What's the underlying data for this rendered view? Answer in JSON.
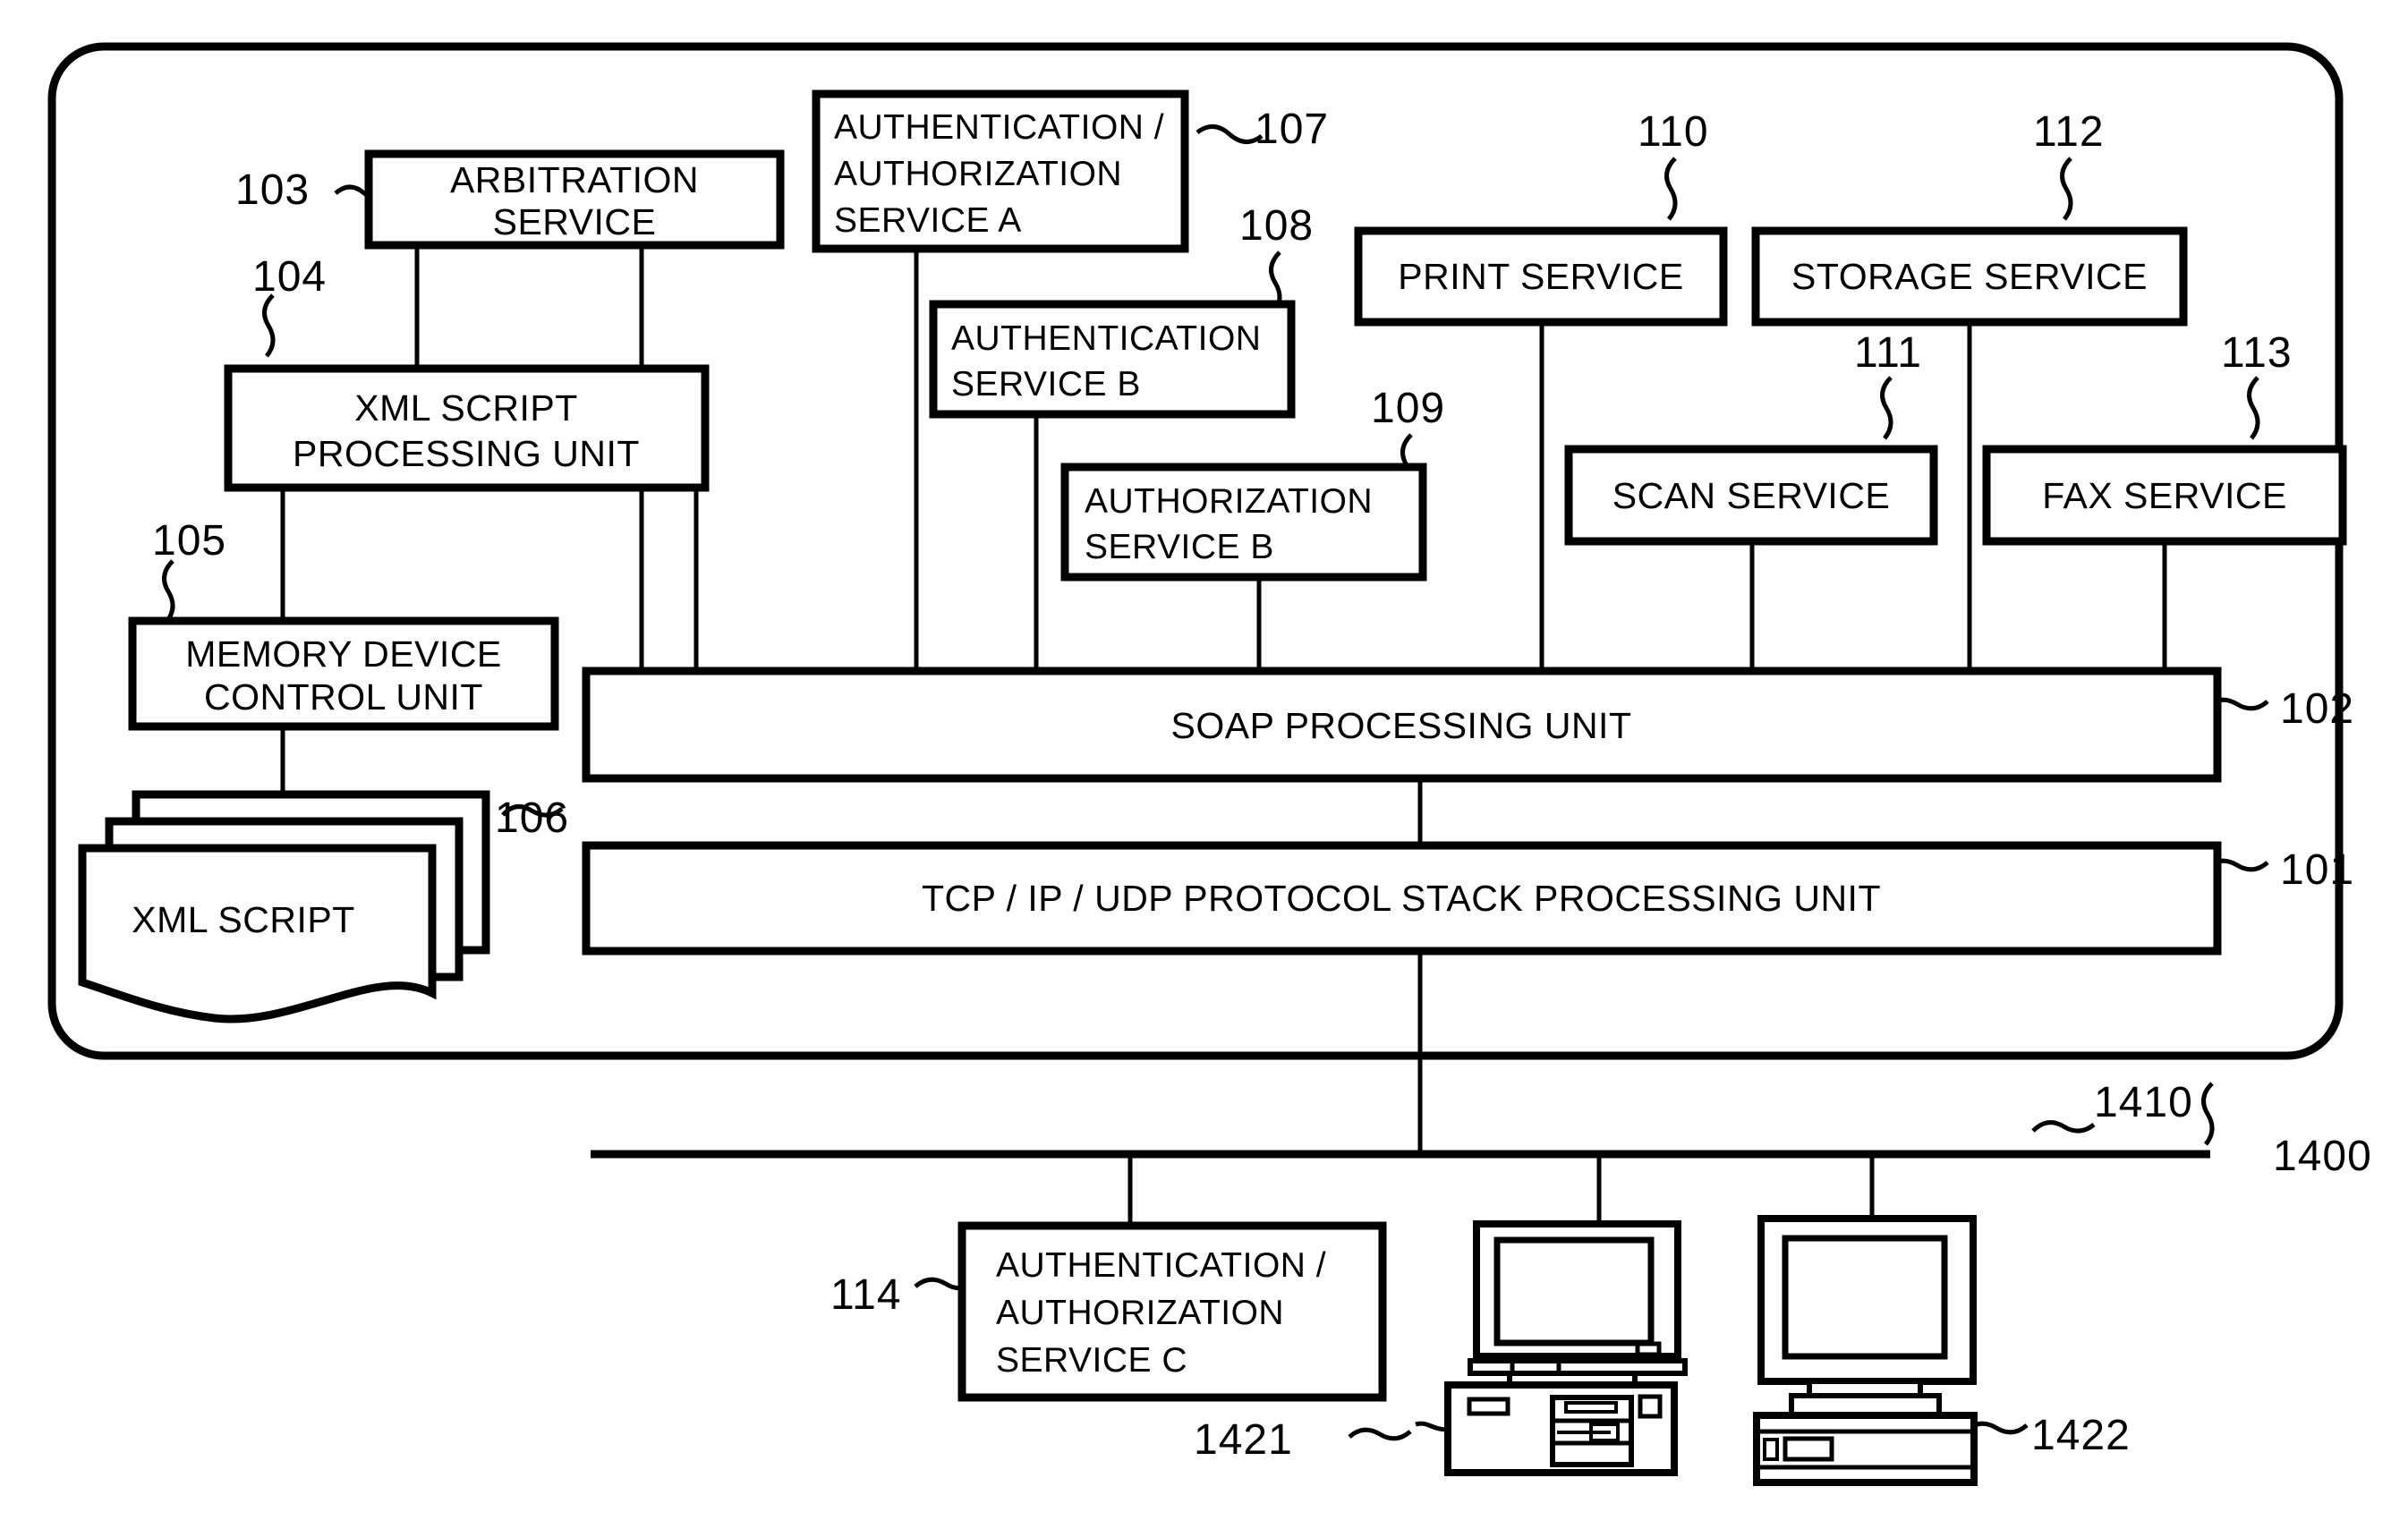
{
  "figure": {
    "type": "patent-block-diagram",
    "description": "Network service architecture block diagram"
  },
  "outer_device": {
    "ref": "",
    "blocks": {
      "arbitration_service": {
        "label_line1": "ARBITRATION",
        "label_line2": "SERVICE",
        "ref": "103"
      },
      "xml_script_processing_unit": {
        "label_line1": "XML SCRIPT",
        "label_line2": "PROCESSING UNIT",
        "ref": "104"
      },
      "memory_device_control_unit": {
        "label_line1": "MEMORY DEVICE",
        "label_line2": "CONTROL UNIT",
        "ref": "105"
      },
      "xml_script": {
        "label": "XML SCRIPT",
        "ref": "106"
      },
      "auth_authz_service_a": {
        "label_line1": "AUTHENTICATION /",
        "label_line2": "AUTHORIZATION",
        "label_line3": "SERVICE A",
        "ref": "107"
      },
      "authentication_service_b": {
        "label_line1": "AUTHENTICATION",
        "label_line2": "SERVICE B",
        "ref": "108"
      },
      "authorization_service_b": {
        "label_line1": "AUTHORIZATION",
        "label_line2": "SERVICE B",
        "ref": "109"
      },
      "print_service": {
        "label": "PRINT SERVICE",
        "ref": "110"
      },
      "scan_service": {
        "label": "SCAN SERVICE",
        "ref": "111"
      },
      "storage_service": {
        "label": "STORAGE SERVICE",
        "ref": "112"
      },
      "fax_service": {
        "label": "FAX SERVICE",
        "ref": "113"
      },
      "soap_processing_unit": {
        "label": "SOAP PROCESSING UNIT",
        "ref": "102"
      },
      "protocol_stack_unit": {
        "label": "TCP / IP / UDP PROTOCOL STACK PROCESSING UNIT",
        "ref": "101"
      }
    }
  },
  "network": {
    "bus_ref": "1410",
    "system_ref": "1400"
  },
  "external_nodes": {
    "auth_authz_service_c": {
      "label_line1": "AUTHENTICATION /",
      "label_line2": "AUTHORIZATION",
      "label_line3": "SERVICE C",
      "ref": "114"
    },
    "computer_1": {
      "ref": "1421",
      "icon": "desktop-computer-icon"
    },
    "computer_2": {
      "ref": "1422",
      "icon": "desktop-computer-icon"
    }
  },
  "colors": {
    "ink": "#000000",
    "paper": "#ffffff"
  }
}
